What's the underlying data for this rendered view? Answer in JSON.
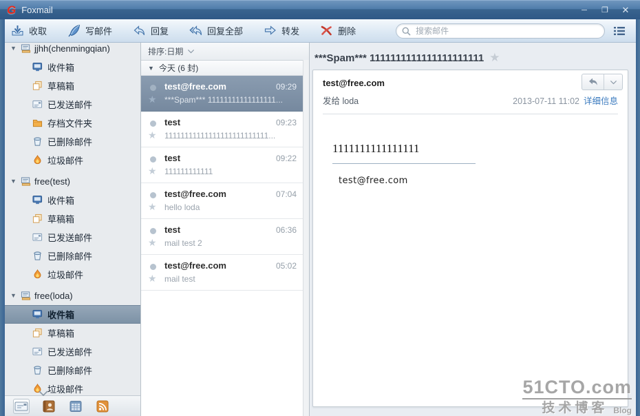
{
  "window": {
    "title": "Foxmail",
    "minimize": "─",
    "maximize": "❐",
    "close": "✕"
  },
  "toolbar": {
    "receive": "收取",
    "compose": "写邮件",
    "reply": "回复",
    "reply_all": "回复全部",
    "forward": "转发",
    "delete": "删除",
    "search_placeholder": "搜索邮件"
  },
  "sidebar": {
    "accounts": [
      {
        "name": "jjhh(chenmingqian)",
        "folders": [
          {
            "label": "收件箱",
            "icon": "inbox-icon"
          },
          {
            "label": "草稿箱",
            "icon": "drafts-icon"
          },
          {
            "label": "已发送邮件",
            "icon": "sent-icon"
          },
          {
            "label": "存档文件夹",
            "icon": "archive-icon"
          },
          {
            "label": "已删除邮件",
            "icon": "trash-icon"
          },
          {
            "label": "垃圾邮件",
            "icon": "junk-icon"
          }
        ]
      },
      {
        "name": "free(test)",
        "folders": [
          {
            "label": "收件箱",
            "icon": "inbox-icon"
          },
          {
            "label": "草稿箱",
            "icon": "drafts-icon"
          },
          {
            "label": "已发送邮件",
            "icon": "sent-icon"
          },
          {
            "label": "已删除邮件",
            "icon": "trash-icon"
          },
          {
            "label": "垃圾邮件",
            "icon": "junk-icon"
          }
        ]
      },
      {
        "name": "free(loda)",
        "selected_folder": "收件箱",
        "folders": [
          {
            "label": "收件箱",
            "icon": "inbox-icon"
          },
          {
            "label": "草稿箱",
            "icon": "drafts-icon"
          },
          {
            "label": "已发送邮件",
            "icon": "sent-icon"
          },
          {
            "label": "已删除邮件",
            "icon": "trash-icon"
          },
          {
            "label": "垃圾邮件",
            "icon": "junk-icon"
          }
        ]
      }
    ]
  },
  "mail_list": {
    "sort_label": "排序:日期",
    "group_label": "今天 (6 封)",
    "items": [
      {
        "sender": "test@free.com",
        "time": "09:29",
        "subject": "***Spam*** 11111111111111111...",
        "selected": true
      },
      {
        "sender": "test",
        "time": "09:23",
        "subject": "11111111111111111111111111..."
      },
      {
        "sender": "test",
        "time": "09:22",
        "subject": "111111111111"
      },
      {
        "sender": "test@free.com",
        "time": "07:04",
        "subject": "hello loda"
      },
      {
        "sender": "test",
        "time": "06:36",
        "subject": "mail test 2"
      },
      {
        "sender": "test@free.com",
        "time": "05:02",
        "subject": "mail test"
      }
    ]
  },
  "reading_pane": {
    "title": "***Spam*** 1111111111111111111111",
    "star": "★",
    "from": "test@free.com",
    "to": "发给 loda",
    "date": "2013-07-11 11:02",
    "details_link": "详细信息",
    "body_heading": "1111111111111111",
    "body_text": "test@free.com"
  },
  "watermark": {
    "site": "51CTO.com",
    "tagline": "技术博客",
    "blog": "Blog"
  },
  "colors": {
    "titlebar_top": "#5d87b4",
    "titlebar_bottom": "#2f5886",
    "toolbar_bottom": "#cddded",
    "accent_blue": "#4a79ad",
    "selection_slate": "#7e93a9",
    "link_blue": "#3b7bbf",
    "delete_red": "#c43a2c",
    "watermark_gray": "#a2a2a2"
  }
}
